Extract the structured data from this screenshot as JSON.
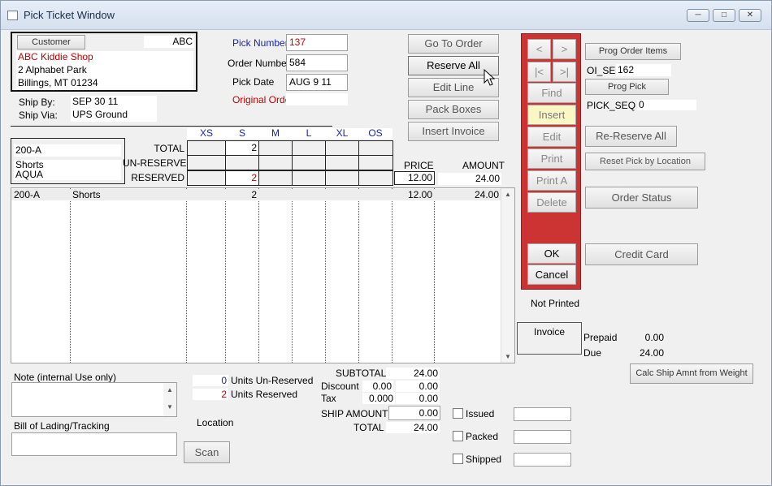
{
  "window": {
    "title": "Pick Ticket Window"
  },
  "customer": {
    "button_label": "Customer",
    "code": "ABC",
    "name": "ABC Kiddie Shop",
    "address1": "2 Alphabet Park",
    "address2": "Billings, MT 01234",
    "ship_by_label": "Ship By:",
    "ship_by": "SEP 30 11",
    "ship_via_label": "Ship Via:",
    "ship_via": "UPS Ground"
  },
  "pick": {
    "pick_number_label": "Pick Number",
    "pick_number": "137",
    "order_number_label": "Order Number",
    "order_number": "584",
    "pick_date_label": "Pick Date",
    "pick_date": "AUG 9 11",
    "original_order_label": "Original Order",
    "original_order": ""
  },
  "actions": {
    "go_to_order": "Go To Order",
    "reserve_all": "Reserve All",
    "edit_line": "Edit Line",
    "pack_boxes": "Pack Boxes",
    "insert_invoice": "Insert Invoice"
  },
  "nav": {
    "prev": "<",
    "next": ">",
    "first": "|<",
    "last": ">|",
    "find": "Find",
    "insert": "Insert",
    "edit": "Edit",
    "print": "Print",
    "print_a": "Print A",
    "delete": "Delete",
    "ok": "OK",
    "cancel": "Cancel"
  },
  "right": {
    "prog_order_items": "Prog Order Items",
    "oi_se_label": "OI_SE",
    "oi_se": "162",
    "prog_pick": "Prog Pick",
    "pick_seq_label": "PICK_SEQ",
    "pick_seq": "0",
    "re_reserve_all": "Re-Reserve All",
    "reset_pick_by_location": "Reset Pick by Location",
    "order_status": "Order Status",
    "credit_card": "Credit Card",
    "not_printed": "Not Printed",
    "invoice": "Invoice",
    "prepaid_label": "Prepaid",
    "prepaid": "0.00",
    "due_label": "Due",
    "due": "24.00",
    "calc_ship": "Calc Ship Amnt from Weight"
  },
  "item": {
    "style": "200-A",
    "desc": "Shorts",
    "color": "AQUA",
    "total_label": "TOTAL",
    "unreserved_label": "UN-RESERVED",
    "reserved_label": "RESERVED",
    "sizes": [
      "XS",
      "S",
      "M",
      "L",
      "XL",
      "OS"
    ],
    "total": [
      "",
      "2",
      "",
      "",
      "",
      ""
    ],
    "unreserved": [
      "",
      "",
      "",
      "",
      "",
      ""
    ],
    "reserved": [
      "",
      "2",
      "",
      "",
      "",
      ""
    ],
    "price_label": "PRICE",
    "price": "12.00",
    "amount_label": "AMOUNT",
    "amount": "24.00"
  },
  "lines": [
    {
      "style": "200-A",
      "desc": "Shorts",
      "s_qty": "2",
      "price": "12.00",
      "amount": "24.00"
    }
  ],
  "bottom": {
    "note_label": "Note (internal Use only)",
    "note": "",
    "bol_label": "Bill of Lading/Tracking",
    "bol": "",
    "units_unreserved_count": "0",
    "units_unreserved_label": "Units Un-Reserved",
    "units_reserved_count": "2",
    "units_reserved_label": "Units Reserved",
    "location_label": "Location",
    "scan": "Scan",
    "subtotal_label": "SUBTOTAL",
    "subtotal": "24.00",
    "discount_label": "Discount",
    "discount_pct": "0.00",
    "discount": "0.00",
    "tax_label": "Tax",
    "tax_rate": "0.000",
    "tax": "0.00",
    "ship_amount_label": "SHIP AMOUNT",
    "ship_amount": "0.00",
    "total_label": "TOTAL",
    "total": "24.00",
    "issued_label": "Issued",
    "packed_label": "Packed",
    "shipped_label": "Shipped"
  }
}
